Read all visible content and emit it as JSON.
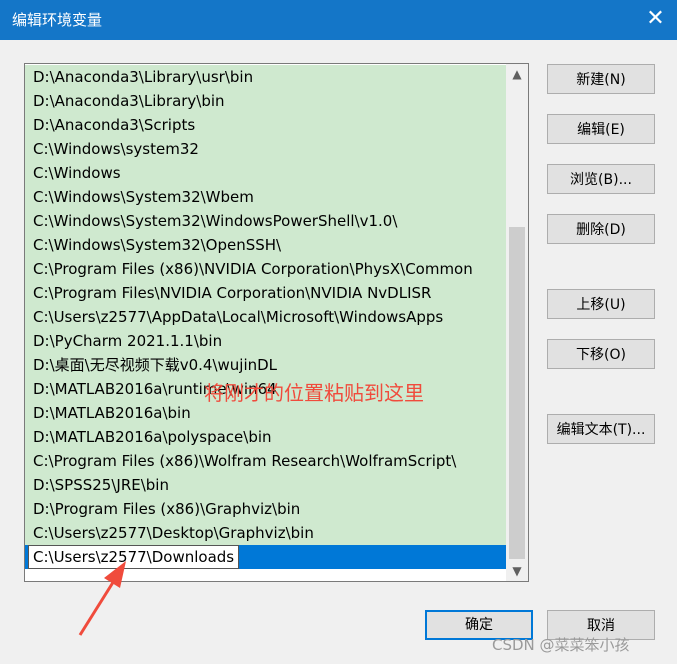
{
  "window": {
    "title": "编辑环境变量",
    "close_glyph": "✕"
  },
  "list": {
    "items": [
      "D:\\Anaconda3\\Library\\usr\\bin",
      "D:\\Anaconda3\\Library\\bin",
      "D:\\Anaconda3\\Scripts",
      "C:\\Windows\\system32",
      "C:\\Windows",
      "C:\\Windows\\System32\\Wbem",
      "C:\\Windows\\System32\\WindowsPowerShell\\v1.0\\",
      "C:\\Windows\\System32\\OpenSSH\\",
      "C:\\Program Files (x86)\\NVIDIA Corporation\\PhysX\\Common",
      "C:\\Program Files\\NVIDIA Corporation\\NVIDIA NvDLISR",
      "C:\\Users\\z2577\\AppData\\Local\\Microsoft\\WindowsApps",
      "D:\\PyCharm 2021.1.1\\bin",
      "D:\\桌面\\无尽视频下载v0.4\\wujinDL",
      "D:\\MATLAB2016a\\runtime\\win64",
      "D:\\MATLAB2016a\\bin",
      "D:\\MATLAB2016a\\polyspace\\bin",
      "C:\\Program Files (x86)\\Wolfram Research\\WolframScript\\",
      "D:\\SPSS25\\JRE\\bin",
      "D:\\Program Files (x86)\\Graphviz\\bin",
      "C:\\Users\\z2577\\Desktop\\Graphviz\\bin"
    ],
    "editing_value": "C:\\Users\\z2577\\Downloads",
    "scroll_up_glyph": "▲",
    "scroll_down_glyph": "▼"
  },
  "buttons": {
    "new": "新建(N)",
    "edit": "编辑(E)",
    "browse": "浏览(B)...",
    "delete": "删除(D)",
    "move_up": "上移(U)",
    "move_down": "下移(O)",
    "edit_text": "编辑文本(T)...",
    "ok": "确定",
    "cancel": "取消"
  },
  "annotation": {
    "text": "将刚才的位置粘贴到这里",
    "color": "#f04b3c"
  },
  "watermark": "CSDN @菜菜笨小孩",
  "colors": {
    "title_bar": "#1476c8",
    "row_bg": "#cfe9cf",
    "selection": "#0078d7"
  }
}
